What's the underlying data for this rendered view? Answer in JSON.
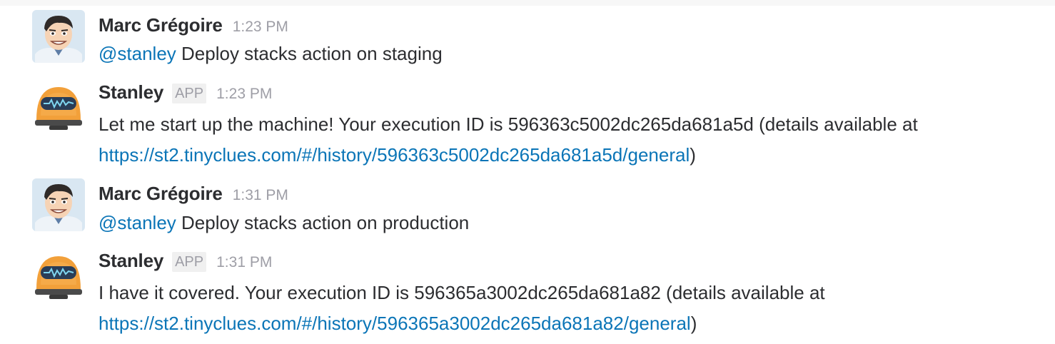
{
  "messages": [
    {
      "author": "Marc Grégoire",
      "time": "1:23 PM",
      "mention": "@stanley",
      "text": " Deploy stacks action on staging"
    },
    {
      "author": "Stanley",
      "badge": "APP",
      "time": "1:23 PM",
      "line1": "Let me start up the machine! Your execution ID is 596363c5002dc265da681a5d (details available at",
      "link": "https://st2.tinyclues.com/#/history/596363c5002dc265da681a5d/general",
      "after_link": ")"
    },
    {
      "author": "Marc Grégoire",
      "time": "1:31 PM",
      "mention": "@stanley",
      "text": " Deploy stacks action on production"
    },
    {
      "author": "Stanley",
      "badge": "APP",
      "time": "1:31 PM",
      "line1": "I have it covered. Your execution ID is 596365a3002dc265da681a82 (details available at",
      "link": "https://st2.tinyclues.com/#/history/596365a3002dc265da681a82/general",
      "after_link": ")"
    }
  ],
  "colors": {
    "link": "#0b75b7",
    "text": "#2c2d30",
    "muted": "#9e9ea6",
    "bot_orange": "#f2a03a"
  },
  "icons": {
    "user_avatar": "cartoon-man-avatar-icon",
    "bot_avatar": "robot-avatar-icon"
  }
}
